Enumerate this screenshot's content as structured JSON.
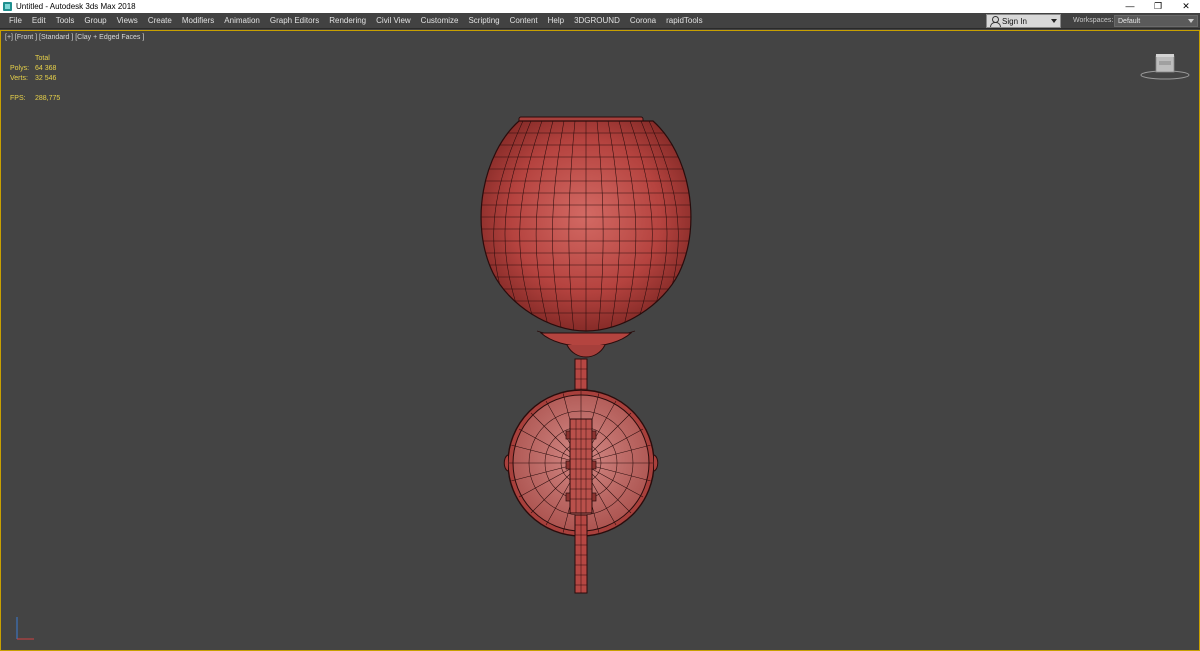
{
  "titlebar": {
    "title": "Untitled - Autodesk 3ds Max 2018",
    "minimize_symbol": "—",
    "restore_symbol": "❐",
    "close_symbol": "✕"
  },
  "menu": {
    "items": [
      "File",
      "Edit",
      "Tools",
      "Group",
      "Views",
      "Create",
      "Modifiers",
      "Animation",
      "Graph Editors",
      "Rendering",
      "Civil View",
      "Customize",
      "Scripting",
      "Content",
      "Help",
      "3DGROUND",
      "Corona",
      "rapidTools"
    ]
  },
  "account": {
    "signin_label": "Sign In"
  },
  "workspaces": {
    "label": "Workspaces:",
    "value": "Default"
  },
  "viewport": {
    "label": "[+] [Front ] [Standard ] [Clay + Edged Faces ]",
    "stats": {
      "header": "Total",
      "polys_label": "Polys:",
      "polys_value": "64 368",
      "verts_label": "Verts:",
      "verts_value": "32 546",
      "fps_label": "FPS:",
      "fps_value": "288,775"
    }
  },
  "colors": {
    "viewport_bg": "#444444",
    "model_fill": "#b84a46",
    "model_edges": "#2a0c0c",
    "stats_text": "#e8d24a",
    "active_border": "#c8a000"
  },
  "icons": {
    "app": "app-icon",
    "user": "user-icon",
    "viewcube": "viewcube-icon",
    "axis": "axis-tripod-icon"
  }
}
